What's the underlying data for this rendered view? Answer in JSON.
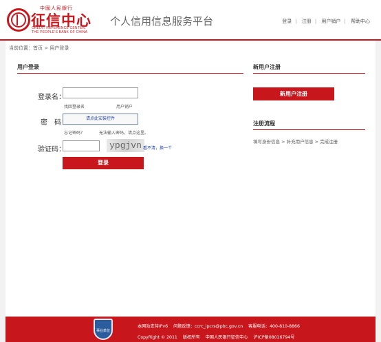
{
  "header": {
    "logo_top_text": "中國人民銀行",
    "logo_main_text": "征信中心",
    "logo_en_line1": "CREDIT REFERENCE CENTER,",
    "logo_en_line2": "THE PEOPLE'S BANK OF CHINA",
    "site_title": "个人信用信息服务平台",
    "nav": [
      "登录",
      "注册",
      "用户销户",
      "帮助中心"
    ],
    "accent_color": "#c8161d"
  },
  "breadcrumb": "当前位置：首页 > 用户登录",
  "login": {
    "title": "用户登录",
    "username_label": "登录名：",
    "retrieve_username": "找回登录名",
    "cancel_account": "用户销户",
    "password_label": "密　码：",
    "install_control": "请点此安装控件",
    "forgot_password": "忘记密码？",
    "cannot_input": "无法输入密码，请点这里。",
    "captcha_label": "验证码：",
    "captcha_text": "ypgjvn",
    "captcha_refresh": "看不清，换一个",
    "submit_button": "登录"
  },
  "register": {
    "title": "新用户注册",
    "button": "新用户注册",
    "process_title": "注册流程",
    "process_text": "填写身份信息 > 补充用户信息 > 完成注册"
  },
  "footer": {
    "badge_text": "事业单位",
    "ipv6": "本网站支持IPv6",
    "feedback": "问题反馈：ccrc_ipcrs@pbc.gov.cn",
    "hotline": "客服电话：400-810-8866",
    "copyright": "CopyRight © 2011",
    "rights": "版权所有",
    "org": "中国人民银行征信中心",
    "icp": "沪ICP备08016794号"
  }
}
